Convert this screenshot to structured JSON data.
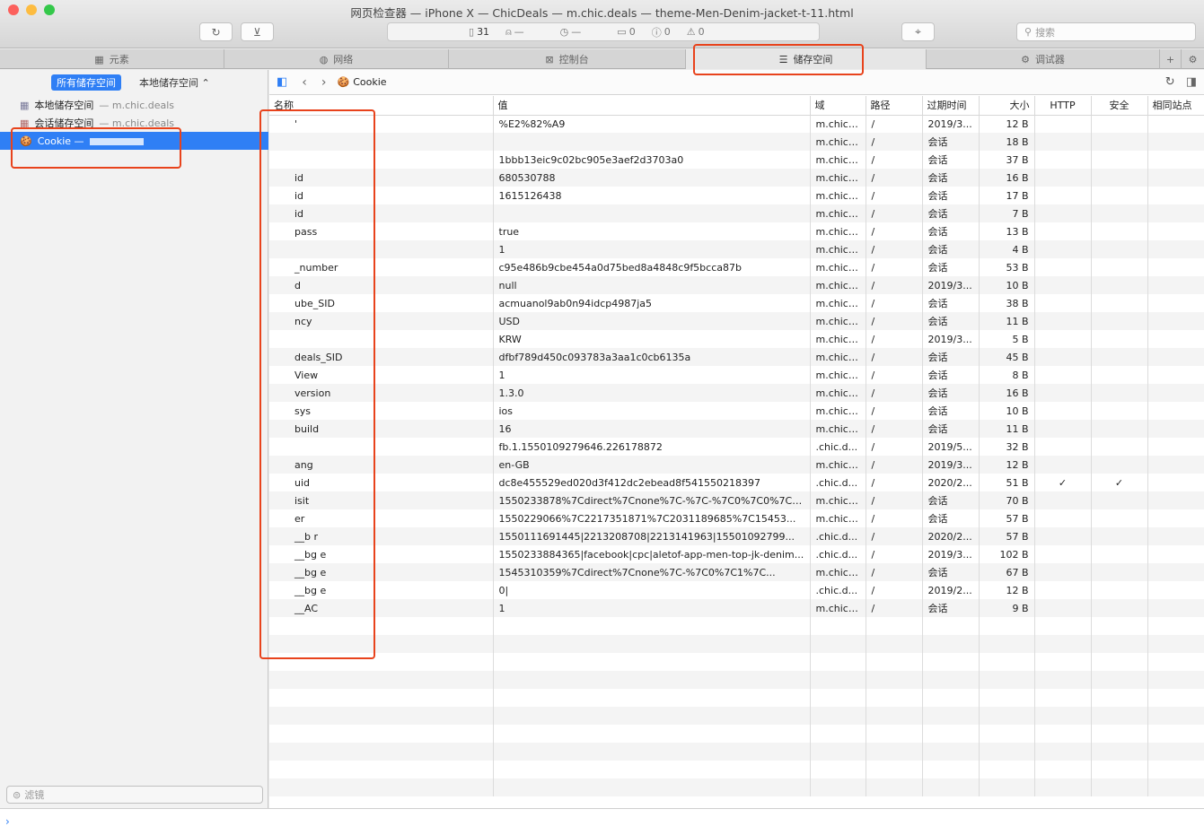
{
  "window": {
    "title": "网页检查器 — iPhone X — ChicDeals — m.chic.deals — theme-Men-Denim-jacket-t-11.html"
  },
  "toolbar": {
    "doc_count": "31",
    "warn_dash": "—",
    "time_dash": "—",
    "log_count": "0",
    "error_count": "0",
    "issue_count": "0",
    "search_placeholder": "搜索"
  },
  "tabs": [
    {
      "label": "元素",
      "icon": "elements-icon"
    },
    {
      "label": "网络",
      "icon": "network-icon"
    },
    {
      "label": "控制台",
      "icon": "console-icon"
    },
    {
      "label": "储存空间",
      "icon": "storage-icon"
    },
    {
      "label": "调试器",
      "icon": "debugger-icon"
    }
  ],
  "sidebar": {
    "scope_all": "所有储存空间",
    "scope_local": "本地储存空间 ⌃",
    "items": [
      {
        "label": "本地储存空间",
        "domain": "— m.chic.deals"
      },
      {
        "label": "会话储存空间",
        "domain": "— m.chic.deals"
      },
      {
        "label": "Cookie —",
        "domain": ""
      }
    ],
    "filter_placeholder": "滤镜"
  },
  "content": {
    "crumb": "Cookie"
  },
  "table": {
    "headers": [
      "名称",
      "值",
      "域",
      "路径",
      "过期时间",
      "大小",
      "HTTP",
      "安全",
      "相同站点"
    ],
    "rows": [
      [
        "'",
        "%E2%82%A9",
        "m.chic....",
        "/",
        "2019/3...",
        "12 B",
        "",
        ""
      ],
      [
        "",
        "",
        "m.chic....",
        "/",
        "会话",
        "18 B",
        "",
        ""
      ],
      [
        "",
        "1bbb13eic9c02bc905e3aef2d3703a0",
        "m.chic....",
        "/",
        "会话",
        "37 B",
        "",
        ""
      ],
      [
        "id",
        "680530788",
        "m.chic....",
        "/",
        "会话",
        "16 B",
        "",
        ""
      ],
      [
        "id",
        "1615126438",
        "m.chic....",
        "/",
        "会话",
        "17 B",
        "",
        ""
      ],
      [
        "id",
        "",
        "m.chic....",
        "/",
        "会话",
        "7 B",
        "",
        ""
      ],
      [
        "pass",
        "true",
        "m.chic....",
        "/",
        "会话",
        "13 B",
        "",
        ""
      ],
      [
        "",
        "1",
        "m.chic....",
        "/",
        "会话",
        "4 B",
        "",
        ""
      ],
      [
        "_number",
        "c95e486b9cbe454a0d75bed8a4848c9f5bcca87b",
        "m.chic....",
        "/",
        "会话",
        "53 B",
        "",
        ""
      ],
      [
        "d",
        "null",
        "m.chic....",
        "/",
        "2019/3...",
        "10 B",
        "",
        ""
      ],
      [
        "ube_SID",
        "acmuanol9ab0n94idcp4987ja5",
        "m.chic....",
        "/",
        "会话",
        "38 B",
        "",
        ""
      ],
      [
        "ncy",
        "USD",
        "m.chic....",
        "/",
        "会话",
        "11 B",
        "",
        ""
      ],
      [
        "",
        "KRW",
        "m.chic....",
        "/",
        "2019/3...",
        "5 B",
        "",
        ""
      ],
      [
        "deals_SID",
        "dfbf789d450c093783a3aa1c0cb6135a",
        "m.chic....",
        "/",
        "会话",
        "45 B",
        "",
        ""
      ],
      [
        "View",
        "1",
        "m.chic....",
        "/",
        "会话",
        "8 B",
        "",
        ""
      ],
      [
        "version",
        "1.3.0",
        "m.chic....",
        "/",
        "会话",
        "16 B",
        "",
        ""
      ],
      [
        "sys",
        "ios",
        "m.chic....",
        "/",
        "会话",
        "10 B",
        "",
        ""
      ],
      [
        "build",
        "16",
        "m.chic....",
        "/",
        "会话",
        "11 B",
        "",
        ""
      ],
      [
        "",
        "fb.1.1550109279646.226178872",
        ".chic.d...",
        "/",
        "2019/5...",
        "32 B",
        "",
        ""
      ],
      [
        "ang",
        "en-GB",
        "m.chic....",
        "/",
        "2019/3...",
        "12 B",
        "",
        ""
      ],
      [
        "uid",
        "dc8e455529ed020d3f412dc2ebead8f541550218397",
        ".chic.d...",
        "/",
        "2020/2...",
        "51 B",
        "✓",
        "✓"
      ],
      [
        "isit",
        "1550233878%7Cdirect%7Cnone%7C-%7C-%7C0%7C0%7C0%7C...",
        "m.chic....",
        "/",
        "会话",
        "70 B",
        "",
        ""
      ],
      [
        "er",
        "1550229066%7C2217351871%7C2031189685%7C15453...",
        "m.chic....",
        "/",
        "会话",
        "57 B",
        "",
        ""
      ],
      [
        "__b  r",
        "1550111691445|2213208708|2213141963|15501092799...",
        ".chic.d...",
        "/",
        "2020/2...",
        "57 B",
        "",
        ""
      ],
      [
        "__bg  e",
        "1550233884365|facebook|cpc|aletof-app-men-top-jk-denim...",
        ".chic.d...",
        "/",
        "2019/3...",
        "102 B",
        "",
        ""
      ],
      [
        "__bg  e",
        "1545310359%7Cdirect%7Cnone%7C-%7C0%7C1%7C...",
        "m.chic....",
        "/",
        "会话",
        "67 B",
        "",
        ""
      ],
      [
        "__bg  e",
        "0|",
        ".chic.d...",
        "/",
        "2019/2...",
        "12 B",
        "",
        ""
      ],
      [
        "__AC",
        "1",
        "m.chic....",
        "/",
        "会话",
        "9 B",
        "",
        ""
      ]
    ]
  },
  "colors": {
    "accent": "#2f7ff5",
    "highlight": "#e8431c"
  }
}
